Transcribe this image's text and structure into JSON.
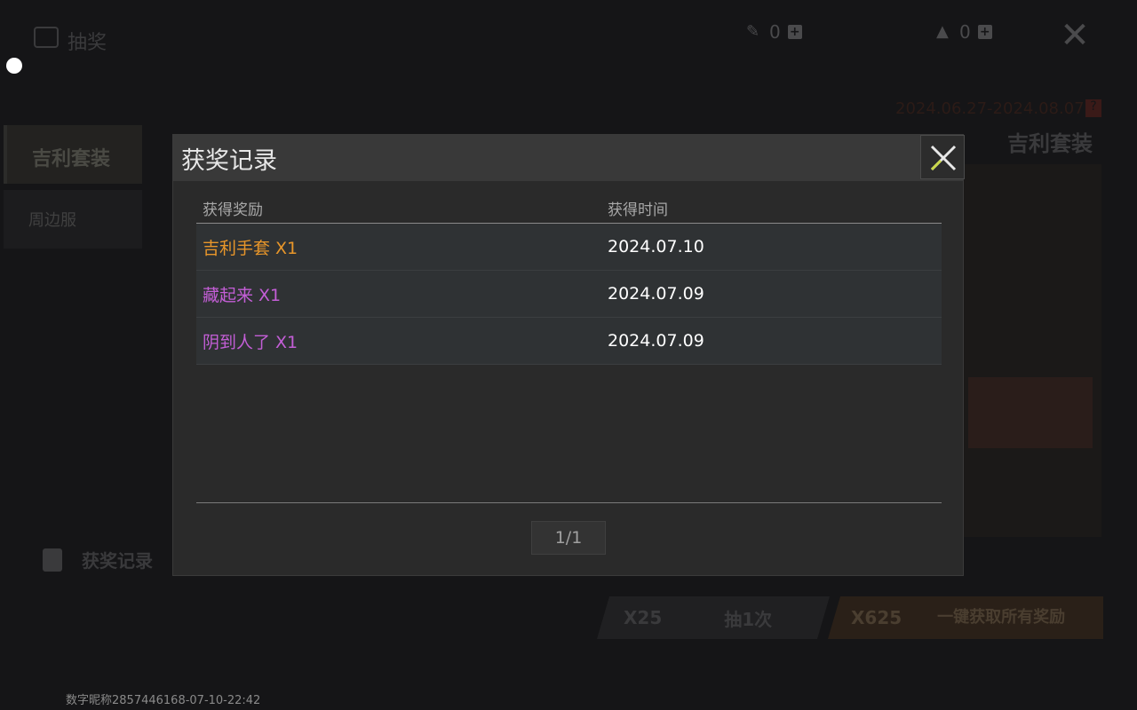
{
  "background": {
    "header_title": "抽奖",
    "currency": [
      {
        "icon": "feather-icon",
        "amount": "0"
      },
      {
        "icon": "warning-gem-icon",
        "amount": "0"
      }
    ],
    "tabs": [
      "吉利套装",
      "周边服"
    ],
    "event_dates": "2024.06.27-2024.08.07",
    "set_name": "吉利套装",
    "record_label": "获奖记录",
    "draw_one": {
      "cost": "X25",
      "label": "抽1次"
    },
    "draw_all": {
      "cost": "X625",
      "label": "一键获取所有奖励"
    },
    "footer_id": "数字昵称2857446168-07-10-22:42"
  },
  "modal": {
    "title": "获奖记录",
    "columns": {
      "reward": "获得奖励",
      "time": "获得时间"
    },
    "records": [
      {
        "reward": "吉利手套 X1",
        "time": "2024.07.10",
        "color": "#e8962a"
      },
      {
        "reward": "藏起来 X1",
        "time": "2024.07.09",
        "color": "#c35ed6"
      },
      {
        "reward": "阴到人了 X1",
        "time": "2024.07.09",
        "color": "#c35ed6"
      }
    ],
    "pager": "1/1"
  }
}
